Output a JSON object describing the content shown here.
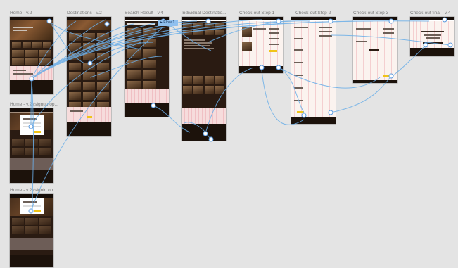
{
  "frame_labels": [
    "Home - v.2",
    "Destinations - v.2",
    "Search Result - v.4",
    "Individual Destinatio...",
    "Check-out Step 1",
    "Check-out Step 2",
    "Check-out Step 3",
    "Check-out final - v.4",
    "Home - v.2 (signup op...",
    "Home - v.2 (signin op..."
  ],
  "flow_tag": "Flow 1",
  "colors": {
    "canvas": "#e4e4e4",
    "frame_dark": "#2a1b12",
    "frame_light": "#fbf3ef",
    "accent_pink": "#f6dcdc",
    "button_yellow": "#f0c419",
    "wire_blue": "#6aaee8"
  },
  "icons": {
    "connector": "circle-node-icon",
    "flow_tag_play": "play-icon"
  }
}
